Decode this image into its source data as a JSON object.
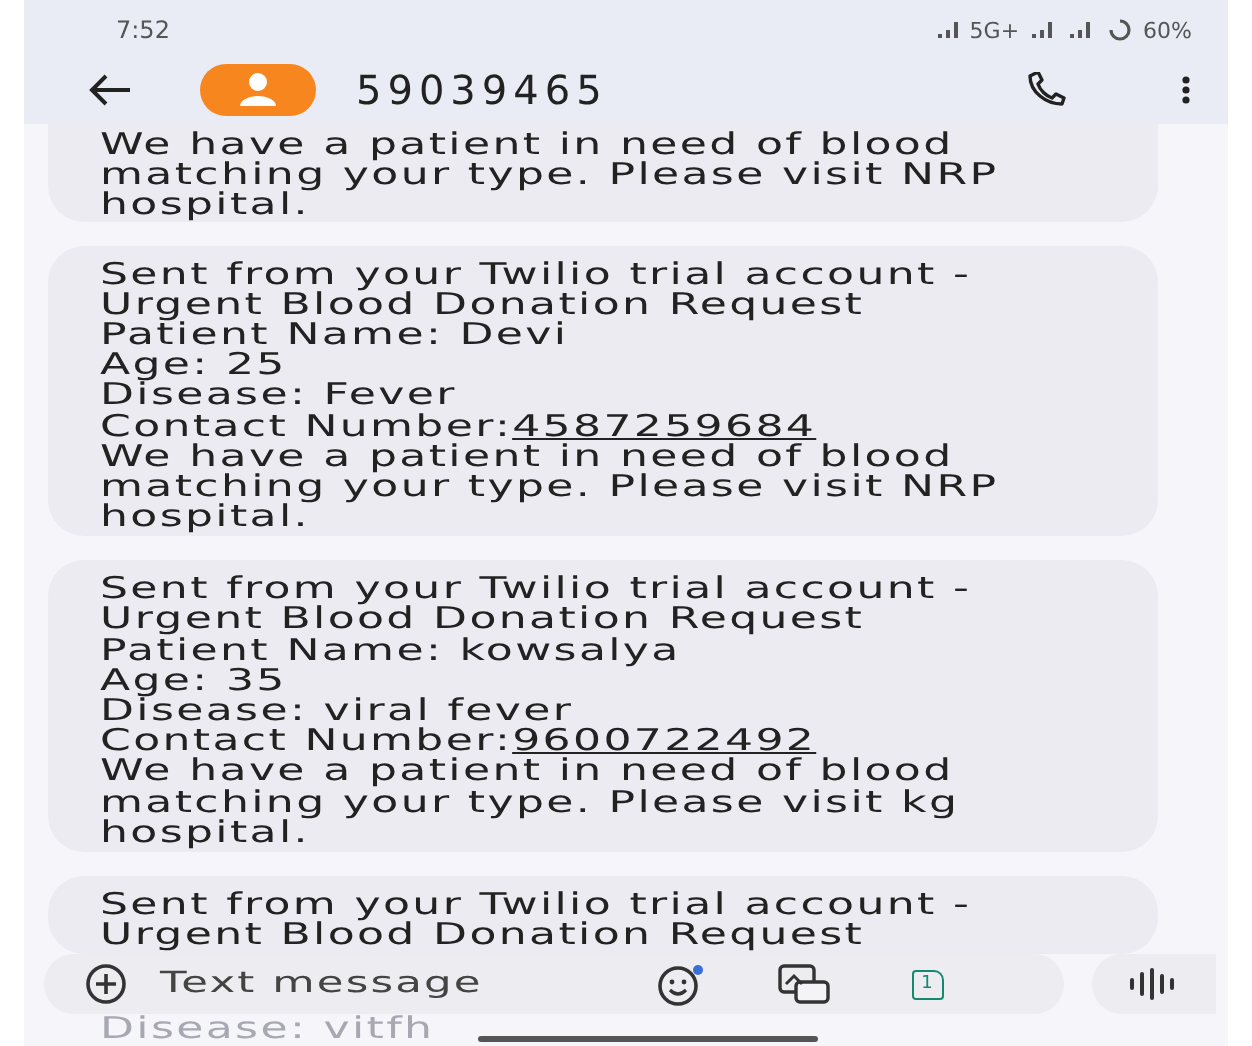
{
  "status_bar": {
    "time": "7:52",
    "network": "5G+",
    "battery": "60%"
  },
  "header": {
    "contact": "59039465"
  },
  "messages": [
    {
      "cut_top": true,
      "lines": [
        {
          "kind": "text",
          "text": "We have a patient in need of blood"
        },
        {
          "kind": "text",
          "text": "matching your type. Please visit NRP"
        },
        {
          "kind": "text",
          "text": "hospital."
        }
      ]
    },
    {
      "cut_top": false,
      "lines": [
        {
          "kind": "text",
          "text": "Sent from your Twilio trial account -"
        },
        {
          "kind": "text",
          "text": "Urgent Blood Donation Request"
        },
        {
          "kind": "text",
          "text": "Patient Name: Devi"
        },
        {
          "kind": "text",
          "text": "Age: 25"
        },
        {
          "kind": "text",
          "text": "Disease: Fever"
        },
        {
          "kind": "link",
          "text": "Contact Number:",
          "link": "4587259684"
        },
        {
          "kind": "text",
          "text": "We have a patient in need of blood"
        },
        {
          "kind": "text",
          "text": "matching your type. Please visit NRP"
        },
        {
          "kind": "text",
          "text": "hospital."
        }
      ]
    },
    {
      "cut_top": false,
      "lines": [
        {
          "kind": "text",
          "text": "Sent from your Twilio trial account -"
        },
        {
          "kind": "text",
          "text": "Urgent Blood Donation Request"
        },
        {
          "kind": "text",
          "text": "Patient Name: kowsalya"
        },
        {
          "kind": "text",
          "text": "Age: 35"
        },
        {
          "kind": "text",
          "text": "Disease: viral fever"
        },
        {
          "kind": "link",
          "text": "Contact Number:",
          "link": "9600722492"
        },
        {
          "kind": "text",
          "text": "We have a patient in need of blood"
        },
        {
          "kind": "text",
          "text": "matching your type. Please visit kg"
        },
        {
          "kind": "text",
          "text": "hospital."
        }
      ]
    },
    {
      "cut_top": false,
      "lines": [
        {
          "kind": "text",
          "text": "Sent from your Twilio trial account -"
        },
        {
          "kind": "text",
          "text": "Urgent Blood Donation Request"
        }
      ]
    }
  ],
  "composer": {
    "placeholder": "Text message",
    "sim": "1"
  },
  "behind_text": "Disease: vitfh"
}
